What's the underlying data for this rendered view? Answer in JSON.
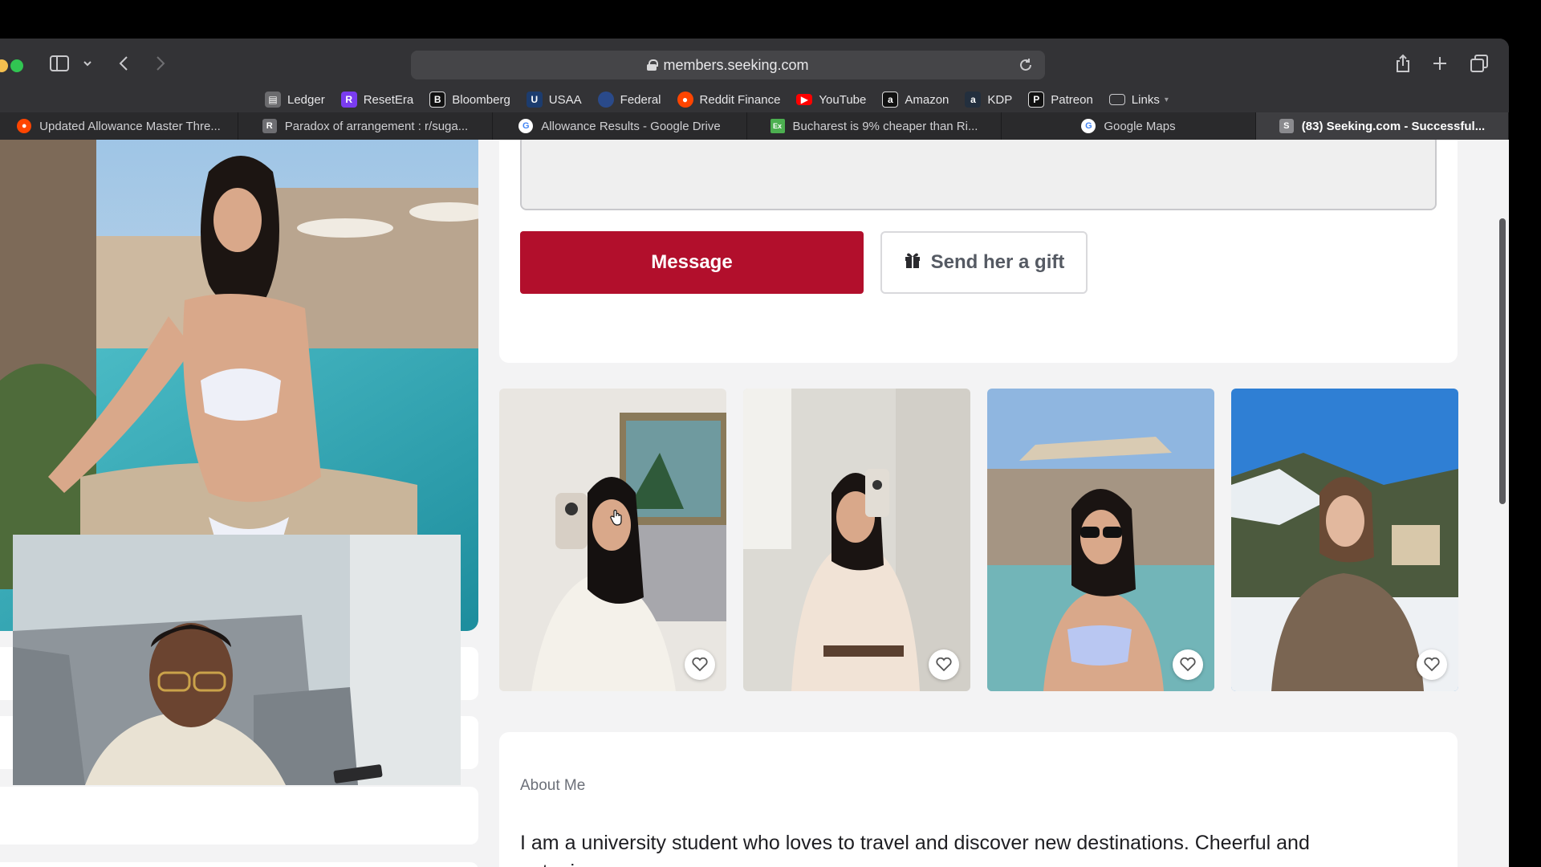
{
  "browser": {
    "url": "members.seeking.com",
    "bookmarks": [
      {
        "label": "Ledger",
        "icon": "ledger-icon",
        "color": "#6b6b6e"
      },
      {
        "label": "ResetEra",
        "icon": "resetera-icon",
        "color": "#7a3cf0"
      },
      {
        "label": "Bloomberg",
        "icon": "bloomberg-icon",
        "color": "#111111"
      },
      {
        "label": "USAA",
        "icon": "usaa-icon",
        "color": "#1c3c6e"
      },
      {
        "label": "Federal",
        "icon": "federal-icon",
        "color": "#2a4a8a"
      },
      {
        "label": "Reddit Finance",
        "icon": "reddit-icon",
        "color": "#ff4500"
      },
      {
        "label": "YouTube",
        "icon": "youtube-icon",
        "color": "#ff0000"
      },
      {
        "label": "Amazon",
        "icon": "amazon-icon",
        "color": "#111111"
      },
      {
        "label": "KDP",
        "icon": "kdp-icon",
        "color": "#232f3e"
      },
      {
        "label": "Patreon",
        "icon": "patreon-icon",
        "color": "#111111"
      },
      {
        "label": "Links",
        "icon": "folder-icon",
        "color": "#555555"
      }
    ],
    "tabs": [
      {
        "label": "Updated Allowance Master Thre...",
        "fav": "reddit",
        "color": "#ff4500",
        "letter": ""
      },
      {
        "label": "Paradox of arrangement : r/suga...",
        "fav": "r",
        "color": "#6e6e72",
        "letter": "R"
      },
      {
        "label": "Allowance Results - Google Drive",
        "fav": "google",
        "color": "#ffffff",
        "letter": "G"
      },
      {
        "label": "Bucharest is 9% cheaper than Ri...",
        "fav": "exp",
        "color": "#4caf50",
        "letter": "Ex"
      },
      {
        "label": "Google Maps",
        "fav": "google",
        "color": "#ffffff",
        "letter": "G"
      },
      {
        "label": "(83) Seeking.com - Successful...",
        "fav": "s",
        "color": "#8a8a8e",
        "letter": "S"
      }
    ]
  },
  "profile": {
    "message_button": "Message",
    "gift_button": "Send her a gift",
    "about_title": "About Me",
    "about_text": "I am a university student who loves to travel and discover new destinations. Cheerful and outgoing"
  },
  "colors": {
    "brand_red": "#b20f2c",
    "page_bg": "#f3f3f4"
  }
}
